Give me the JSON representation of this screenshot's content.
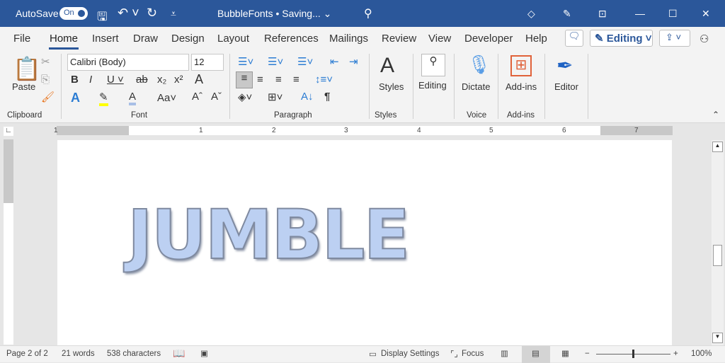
{
  "titlebar": {
    "autosave": "AutoSave",
    "toggle": "On",
    "doc_title": "BubbleFonts • Saving... ⌄"
  },
  "tabs": [
    "File",
    "Home",
    "Insert",
    "Draw",
    "Design",
    "Layout",
    "References",
    "Mailings",
    "Review",
    "View",
    "Developer",
    "Help"
  ],
  "header_buttons": {
    "editing": "Editing"
  },
  "ribbon": {
    "paste": "Paste",
    "font_name": "Calibri (Body)",
    "font_size": "12",
    "styles": "Styles",
    "editing": "Editing",
    "dictate": "Dictate",
    "addins": "Add-ins",
    "editor": "Editor",
    "groups": [
      "Clipboard",
      "Font",
      "Paragraph",
      "Styles",
      "Voice",
      "Add-ins"
    ]
  },
  "ruler": [
    "1",
    "1",
    "2",
    "3",
    "4",
    "5",
    "6",
    "7"
  ],
  "document": {
    "text": "JUMBLE"
  },
  "accent": "#2b579a",
  "status": {
    "page": "Page 2 of 2",
    "words": "21 words",
    "chars": "538 characters",
    "display": "Display Settings",
    "focus": "Focus",
    "zoom": "100%"
  }
}
